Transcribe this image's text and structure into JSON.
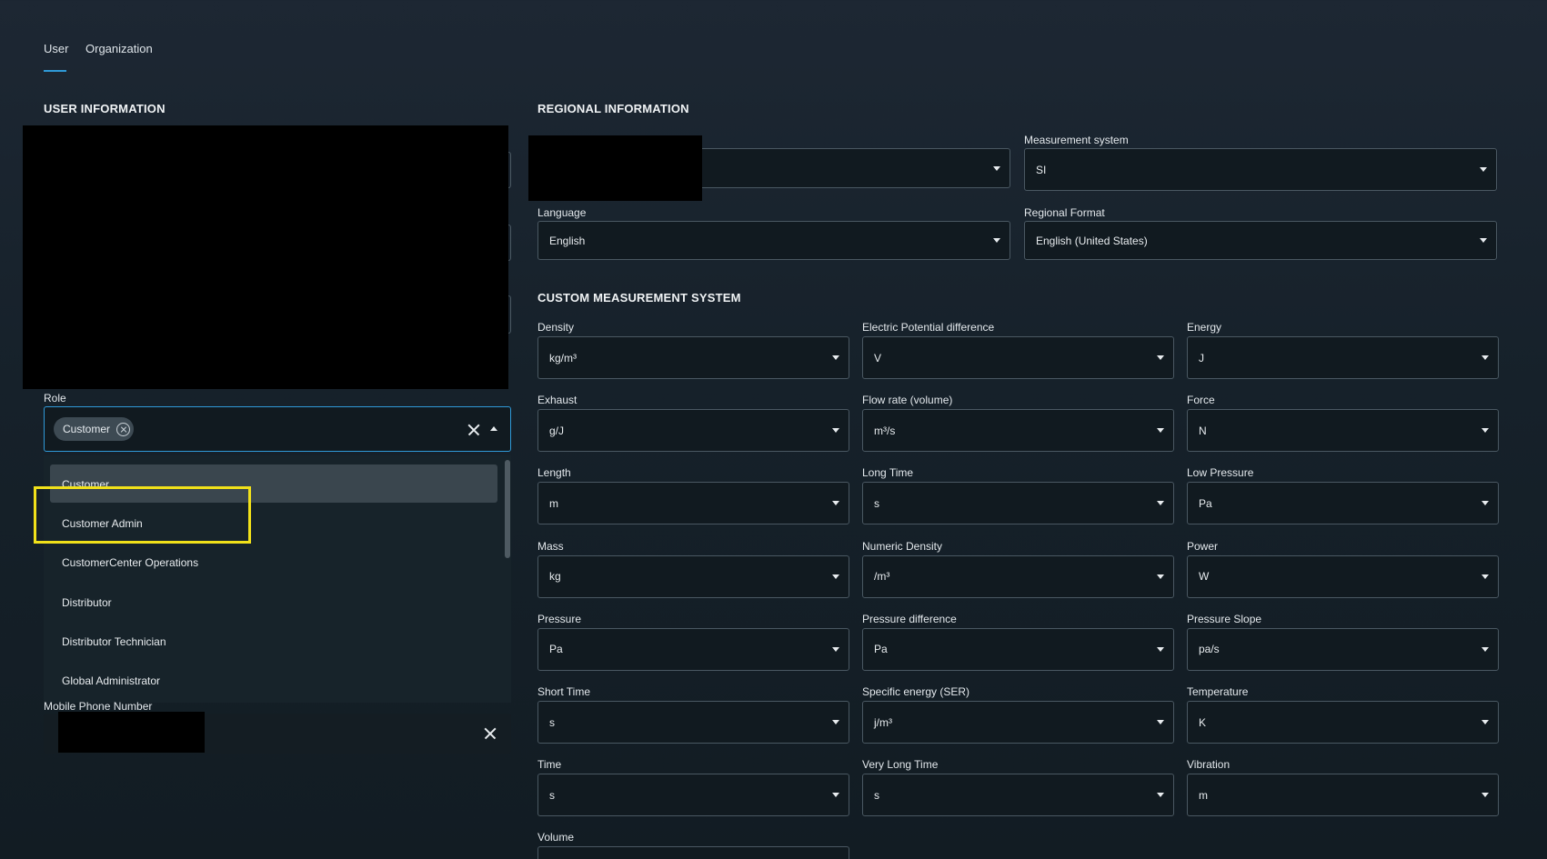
{
  "tabs": [
    {
      "label": "User",
      "active": true
    },
    {
      "label": "Organization",
      "active": false
    }
  ],
  "user_info": {
    "title": "USER INFORMATION",
    "role": {
      "label": "Role",
      "selected_chip": "Customer",
      "options": [
        "Customer",
        "Customer Admin",
        "CustomerCenter Operations",
        "Distributor",
        "Distributor Technician",
        "Global Administrator"
      ]
    },
    "mobile_label": "Mobile Phone Number"
  },
  "regional": {
    "title": "REGIONAL INFORMATION",
    "measurement_system": {
      "label": "Measurement system",
      "value": "SI"
    },
    "language": {
      "label": "Language",
      "value": "English"
    },
    "regional_format": {
      "label": "Regional Format",
      "value": "English (United States)"
    }
  },
  "custom": {
    "title": "CUSTOM MEASUREMENT SYSTEM",
    "fields": [
      {
        "label": "Density",
        "value": "kg/m³"
      },
      {
        "label": "Electric Potential difference",
        "value": "V"
      },
      {
        "label": "Energy",
        "value": "J"
      },
      {
        "label": "Exhaust",
        "value": "g/J"
      },
      {
        "label": "Flow rate (volume)",
        "value": "m³/s"
      },
      {
        "label": "Force",
        "value": "N"
      },
      {
        "label": "Length",
        "value": "m"
      },
      {
        "label": "Long Time",
        "value": "s"
      },
      {
        "label": "Low Pressure",
        "value": "Pa"
      },
      {
        "label": "Mass",
        "value": "kg"
      },
      {
        "label": "Numeric Density",
        "value": "/m³"
      },
      {
        "label": "Power",
        "value": "W"
      },
      {
        "label": "Pressure",
        "value": "Pa"
      },
      {
        "label": "Pressure difference",
        "value": "Pa"
      },
      {
        "label": "Pressure Slope",
        "value": "pa/s"
      },
      {
        "label": "Short Time",
        "value": "s"
      },
      {
        "label": "Specific energy (SER)",
        "value": "j/m³"
      },
      {
        "label": "Temperature",
        "value": "K"
      },
      {
        "label": "Time",
        "value": "s"
      },
      {
        "label": "Very Long Time",
        "value": "s"
      },
      {
        "label": "Vibration",
        "value": "m"
      },
      {
        "label": "Volume",
        "value": ""
      }
    ]
  },
  "colors": {
    "accent": "#2f9ad8",
    "highlight": "#f1e11a",
    "background": "#16212a"
  }
}
